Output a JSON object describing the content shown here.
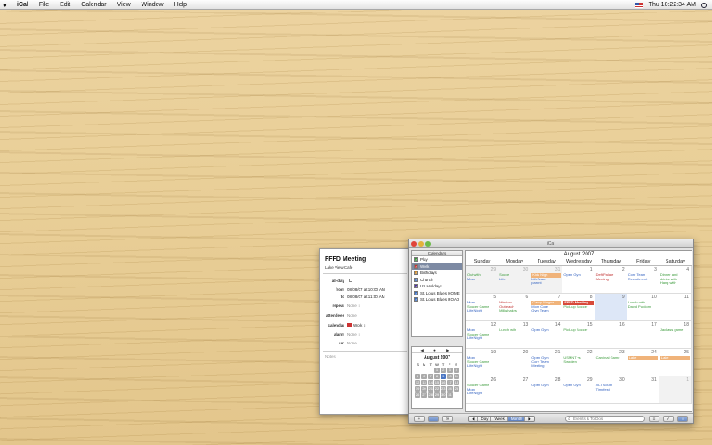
{
  "menubar": {
    "apple": "",
    "items": [
      "iCal",
      "File",
      "Edit",
      "Calendar",
      "View",
      "Window",
      "Help"
    ],
    "clock": "Thu 10:22:34 AM"
  },
  "inspector": {
    "title": "FFFD Meeting",
    "location": "Lake View Café",
    "allday_label": "all-day",
    "from_label": "from",
    "from_value": "08/08/07  at 10:00 AM",
    "to_label": "to",
    "to_value": "08/08/07  at 11:00 AM",
    "repeat_label": "repeat",
    "repeat_value": "None ↕",
    "attendees_label": "attendees",
    "attendees_value": "None",
    "calendar_label": "calendar",
    "calendar_value": "Work ↕",
    "alarm_label": "alarm",
    "alarm_value": "None ↕",
    "url_label": "url",
    "url_value": "None",
    "notes": "Notes"
  },
  "window": {
    "title": "iCal"
  },
  "calendars": {
    "header": "Calendars",
    "items": [
      {
        "label": "Play",
        "color": "#3a9a3a",
        "checked": "✓",
        "selected": false
      },
      {
        "label": "Work",
        "color": "#c33333",
        "checked": "✓",
        "selected": true
      },
      {
        "label": "Birthdays",
        "color": "#cc8a2a",
        "checked": "✓",
        "selected": false
      },
      {
        "label": "Church",
        "color": "#3a6fc4",
        "checked": "✓",
        "selected": false
      },
      {
        "label": "US Holidays",
        "color": "#4b2fa0",
        "checked": "✓",
        "selected": false
      },
      {
        "label": "St. Louis Blues HOME",
        "color": "#3a6fc4",
        "checked": "✓",
        "selected": false
      },
      {
        "label": "St. Louis Blues ROAD",
        "color": "#3a6fc4",
        "checked": "✓",
        "selected": false
      }
    ]
  },
  "minical": {
    "nav": "◀ ● ▶",
    "title": "August 2007",
    "weekdays": [
      "S",
      "M",
      "T",
      "W",
      "T",
      "F",
      "S"
    ],
    "days": [
      "",
      "",
      "",
      "1",
      "2",
      "3",
      "4",
      "5",
      "6",
      "7",
      "8",
      "9",
      "10",
      "11",
      "12",
      "13",
      "14",
      "15",
      "16",
      "17",
      "18",
      "19",
      "20",
      "21",
      "22",
      "23",
      "24",
      "25",
      "26",
      "27",
      "28",
      "29",
      "30",
      "31",
      ""
    ],
    "today": "9"
  },
  "month": {
    "title": "August 2007",
    "weekdays": [
      "Sunday",
      "Monday",
      "Tuesday",
      "Wednesday",
      "Thursday",
      "Friday",
      "Saturday"
    ],
    "cells": [
      {
        "day": "29",
        "other": true,
        "events": [
          {
            "t": "Out with",
            "c": "green"
          },
          {
            "t": "Mom",
            "c": "blue"
          }
        ]
      },
      {
        "day": "30",
        "other": true,
        "events": [
          {
            "t": "Socce",
            "c": "green"
          },
          {
            "t": "Life",
            "c": "blue"
          }
        ]
      },
      {
        "day": "31",
        "other": true,
        "events": [
          {
            "t": "Kids Nigh",
            "c": "bar"
          },
          {
            "t": "LifeTeam",
            "c": "blue"
          },
          {
            "t": "parent",
            "c": "blue"
          }
        ]
      },
      {
        "day": "1",
        "events": [
          {
            "t": "Open Gym",
            "c": "blue"
          }
        ]
      },
      {
        "day": "2",
        "events": [
          {
            "t": "Deft Palate",
            "c": "red"
          },
          {
            "t": "Meeting",
            "c": "red"
          }
        ]
      },
      {
        "day": "3",
        "events": [
          {
            "t": "Core Team",
            "c": "blue"
          },
          {
            "t": "Recruitment",
            "c": "blue"
          }
        ]
      },
      {
        "day": "4",
        "events": [
          {
            "t": "Dinner and",
            "c": "green"
          },
          {
            "t": "drinks with",
            "c": "green"
          },
          {
            "t": "Hang with",
            "c": "green"
          }
        ]
      },
      {
        "day": "5",
        "events": [
          {
            "t": "Mom",
            "c": "blue"
          },
          {
            "t": "Soccer Game",
            "c": "green"
          },
          {
            "t": "Life Night",
            "c": "blue"
          }
        ]
      },
      {
        "day": "6",
        "events": [
          {
            "t": "Mission",
            "c": "red"
          },
          {
            "t": "Outreach",
            "c": "red"
          },
          {
            "t": "Milkshakes",
            "c": "green"
          }
        ]
      },
      {
        "day": "7",
        "events": [
          {
            "t": "Camp Wagne",
            "c": "bar"
          },
          {
            "t": "Mom  Core",
            "c": "blue"
          },
          {
            "t": "Gym  Team",
            "c": "blue"
          }
        ]
      },
      {
        "day": "8",
        "events": [
          {
            "t": "FFFD Meeting",
            "c": "selbar"
          },
          {
            "t": "Pick-up Soccer",
            "c": "green"
          }
        ]
      },
      {
        "day": "9",
        "today": true,
        "events": []
      },
      {
        "day": "10",
        "events": [
          {
            "t": "Lunch with",
            "c": "green"
          },
          {
            "t": "David Purdom",
            "c": "green"
          }
        ]
      },
      {
        "day": "11",
        "events": []
      },
      {
        "day": "12",
        "events": [
          {
            "t": "Mom",
            "c": "blue"
          },
          {
            "t": "Soccer Game",
            "c": "green"
          },
          {
            "t": "Life Night",
            "c": "blue"
          }
        ]
      },
      {
        "day": "13",
        "events": [
          {
            "t": "Lunch with",
            "c": "green"
          }
        ]
      },
      {
        "day": "14",
        "events": [
          {
            "t": "Open Gym",
            "c": "blue"
          }
        ]
      },
      {
        "day": "15",
        "events": [
          {
            "t": "Pick-up Soccer",
            "c": "green"
          }
        ]
      },
      {
        "day": "16",
        "events": []
      },
      {
        "day": "17",
        "events": []
      },
      {
        "day": "18",
        "events": [
          {
            "t": "Jackass game",
            "c": "green"
          }
        ]
      },
      {
        "day": "19",
        "events": [
          {
            "t": "Mom",
            "c": "blue"
          },
          {
            "t": "Soccer Game",
            "c": "green"
          },
          {
            "t": "Life Night",
            "c": "blue"
          }
        ]
      },
      {
        "day": "20",
        "events": []
      },
      {
        "day": "21",
        "events": [
          {
            "t": "Open Gym",
            "c": "blue"
          },
          {
            "t": "Core Team",
            "c": "blue"
          },
          {
            "t": "Meeting",
            "c": "blue"
          }
        ]
      },
      {
        "day": "22",
        "events": [
          {
            "t": "USMNT vs",
            "c": "green"
          },
          {
            "t": "Sweden",
            "c": "green"
          }
        ]
      },
      {
        "day": "23",
        "events": [
          {
            "t": "Cardinal Game",
            "c": "green"
          }
        ]
      },
      {
        "day": "24",
        "events": [
          {
            "t": "Lake",
            "c": "bar"
          }
        ]
      },
      {
        "day": "25",
        "events": [
          {
            "t": "Lake",
            "c": "bar"
          }
        ]
      },
      {
        "day": "26",
        "events": [
          {
            "t": "Soccer Game",
            "c": "green"
          },
          {
            "t": "Mom",
            "c": "blue"
          },
          {
            "t": "Life Night",
            "c": "blue"
          }
        ]
      },
      {
        "day": "27",
        "events": []
      },
      {
        "day": "28",
        "events": [
          {
            "t": "Open Gym",
            "c": "blue"
          }
        ]
      },
      {
        "day": "29",
        "events": [
          {
            "t": "Open Gym",
            "c": "blue"
          }
        ]
      },
      {
        "day": "30",
        "events": [
          {
            "t": "XLT South",
            "c": "blue"
          },
          {
            "t": "Timefest",
            "c": "blue"
          }
        ]
      },
      {
        "day": "31",
        "events": []
      },
      {
        "day": "1",
        "other": true,
        "events": []
      }
    ]
  },
  "toolbar": {
    "add_label": "+",
    "mail_label": "✉",
    "prev_label": "◀",
    "next_label": "▶",
    "day_label": "Day",
    "week_label": "Week",
    "month_label": "Month",
    "search_placeholder": "Events & To Dos",
    "search_icon": "search-icon"
  }
}
